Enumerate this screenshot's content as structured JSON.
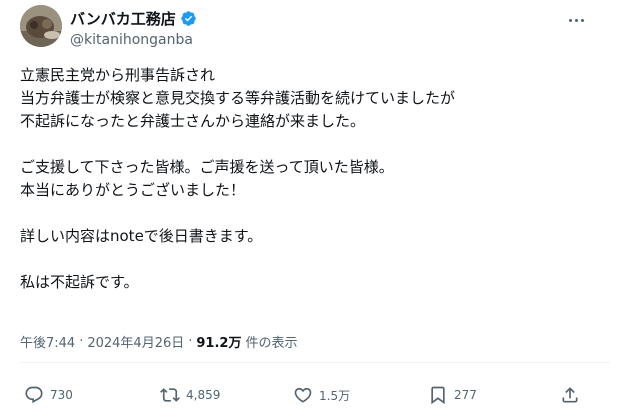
{
  "author": {
    "display_name": "バンバカ工務店",
    "handle": "@kitanihonganba",
    "verified": true
  },
  "post": {
    "lines": [
      "立憲民主党から刑事告訴され",
      "当方弁護士が検察と意見交換する等弁護活動を続けていましたが",
      "不起訴になったと弁護士さんから連絡が来ました。",
      "",
      "ご支援して下さった皆様。ご声援を送って頂いた皆様。",
      "本当にありがとうございました！",
      "",
      "詳しい内容はnoteで後日書きます。",
      "",
      "私は不起訴です。"
    ]
  },
  "meta": {
    "time": "午後7:44",
    "separator": "·",
    "date": "2024年4月26日",
    "views_count": "91.2万",
    "views_label": "件の表示"
  },
  "actions": {
    "replies": "730",
    "reposts": "4,859",
    "likes": "1.5万",
    "bookmarks": "277"
  },
  "colors": {
    "text": "#0f1419",
    "muted": "#536471",
    "verified": "#1d9bf0",
    "divider": "#eff3f4"
  },
  "icons": [
    "more-icon",
    "verified-badge-icon",
    "reply-icon",
    "repost-icon",
    "like-icon",
    "bookmark-icon",
    "share-icon"
  ]
}
